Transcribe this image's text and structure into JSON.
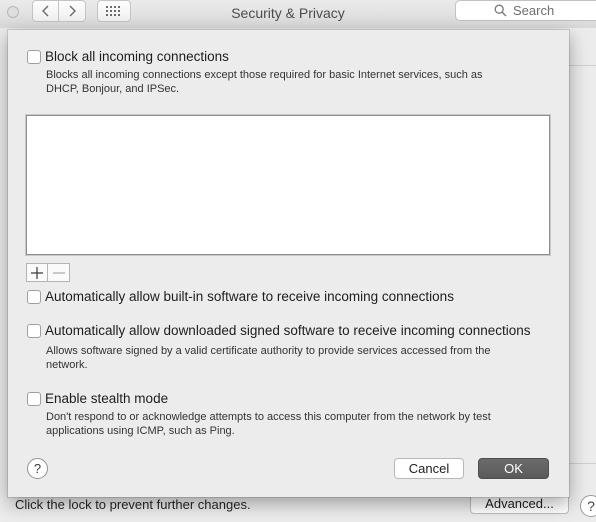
{
  "window": {
    "title": "Security & Privacy",
    "search_placeholder": "Search"
  },
  "firewall_options": {
    "block_all": {
      "label": "Block all incoming connections",
      "checked": false,
      "description_line1": "Blocks all incoming connections except those required for basic Internet services,  such as",
      "description_line2": "DHCP, Bonjour, and IPSec."
    },
    "app_list": [],
    "add_symbol": "+",
    "remove_symbol": "−",
    "allow_builtin": {
      "label": "Automatically allow built-in software to receive incoming connections",
      "checked": false
    },
    "allow_signed": {
      "label": "Automatically allow downloaded signed software to receive incoming connections",
      "checked": false,
      "description_line1": "Allows software signed by a valid certificate authority to provide services accessed from the",
      "description_line2": "network."
    },
    "stealth": {
      "label": "Enable stealth mode",
      "checked": false,
      "description_line1": "Don't respond to or acknowledge attempts to access this computer from the network by test",
      "description_line2": "applications using ICMP, such as Ping."
    },
    "help_label": "?",
    "cancel_label": "Cancel",
    "ok_label": "OK"
  },
  "footer": {
    "lock_text": "Click the lock to prevent further changes.",
    "advanced_label": "Advanced...",
    "help_label": "?"
  },
  "colors": {
    "window_bg": "#ececec",
    "default_button": "#5f5f5f"
  }
}
